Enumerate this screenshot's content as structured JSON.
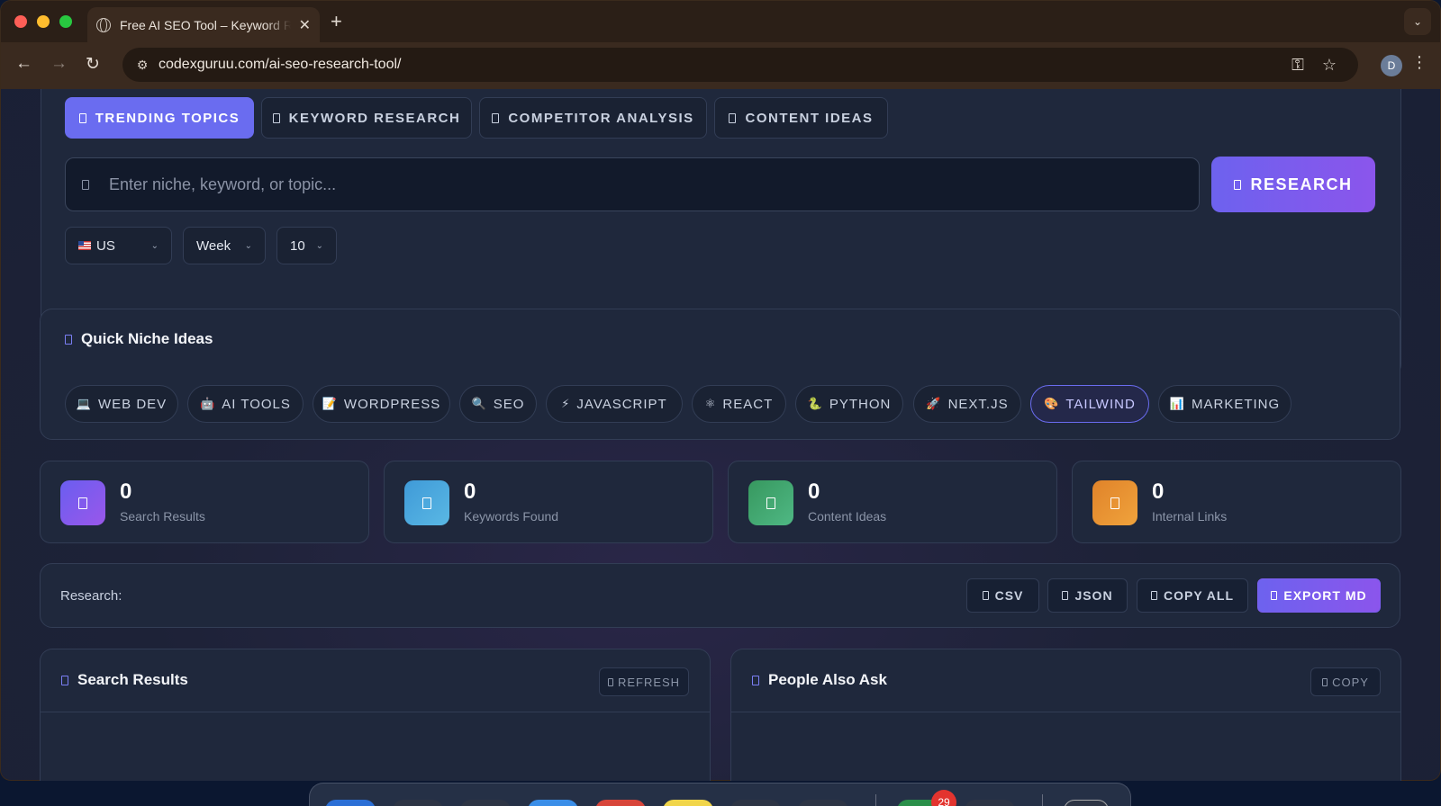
{
  "browser": {
    "tab_title": "Free AI SEO Tool – Keyword Research",
    "tab_close": "✕",
    "new_tab": "+",
    "tab_menu": "⌄",
    "url": "codexguruu.com/ai-seo-research-tool/",
    "avatar_letter": "D",
    "icons": {
      "back": "←",
      "forward": "→",
      "reload": "↻",
      "site_info": "⚙",
      "password": "⚿",
      "bookmark": "☆",
      "menu": "⋮"
    }
  },
  "modes": [
    {
      "label": "TRENDING TOPICS",
      "active": true
    },
    {
      "label": "KEYWORD RESEARCH",
      "active": false
    },
    {
      "label": "COMPETITOR ANALYSIS",
      "active": false
    },
    {
      "label": "CONTENT IDEAS",
      "active": false
    }
  ],
  "search": {
    "placeholder": "Enter niche, keyword, or topic...",
    "value": "",
    "button_label": "RESEARCH"
  },
  "filters": {
    "country": "US",
    "period": "Week",
    "count": "10"
  },
  "niche": {
    "title": "Quick Niche Ideas",
    "chips": [
      {
        "emoji": "💻",
        "label": "WEB DEV",
        "active": false
      },
      {
        "emoji": "🤖",
        "label": "AI TOOLS",
        "active": false
      },
      {
        "emoji": "📝",
        "label": "WORDPRESS",
        "active": false
      },
      {
        "emoji": "🔍",
        "label": "SEO",
        "active": false
      },
      {
        "emoji": "⚡",
        "label": "JAVASCRIPT",
        "active": false
      },
      {
        "emoji": "⚛",
        "label": "REACT",
        "active": false
      },
      {
        "emoji": "🐍",
        "label": "PYTHON",
        "active": false
      },
      {
        "emoji": "🚀",
        "label": "NEXT.JS",
        "active": false
      },
      {
        "emoji": "🎨",
        "label": "TAILWIND",
        "active": true
      },
      {
        "emoji": "📊",
        "label": "MARKETING",
        "active": false
      }
    ]
  },
  "stats": [
    {
      "value": "0",
      "label": "Search Results",
      "color": "#7b5cf0"
    },
    {
      "value": "0",
      "label": "Keywords Found",
      "color": "#4aa8dc"
    },
    {
      "value": "0",
      "label": "Content Ideas",
      "color": "#3fa772"
    },
    {
      "value": "0",
      "label": "Internal Links",
      "color": "#e58f2e"
    }
  ],
  "export": {
    "label": "Research:",
    "csv": "CSV",
    "json": "JSON",
    "copy_all": "COPY ALL",
    "export_md": "EXPORT MD"
  },
  "results_panel": {
    "title": "Search Results",
    "action": "REFRESH"
  },
  "paa_panel": {
    "title": "People Also Ask",
    "action": "COPY"
  },
  "dock": {
    "badge": "29"
  },
  "colors": {
    "accent": "#6a6cf0",
    "accent_gradient_end": "#8b55ec",
    "bg": "#1f283c"
  }
}
